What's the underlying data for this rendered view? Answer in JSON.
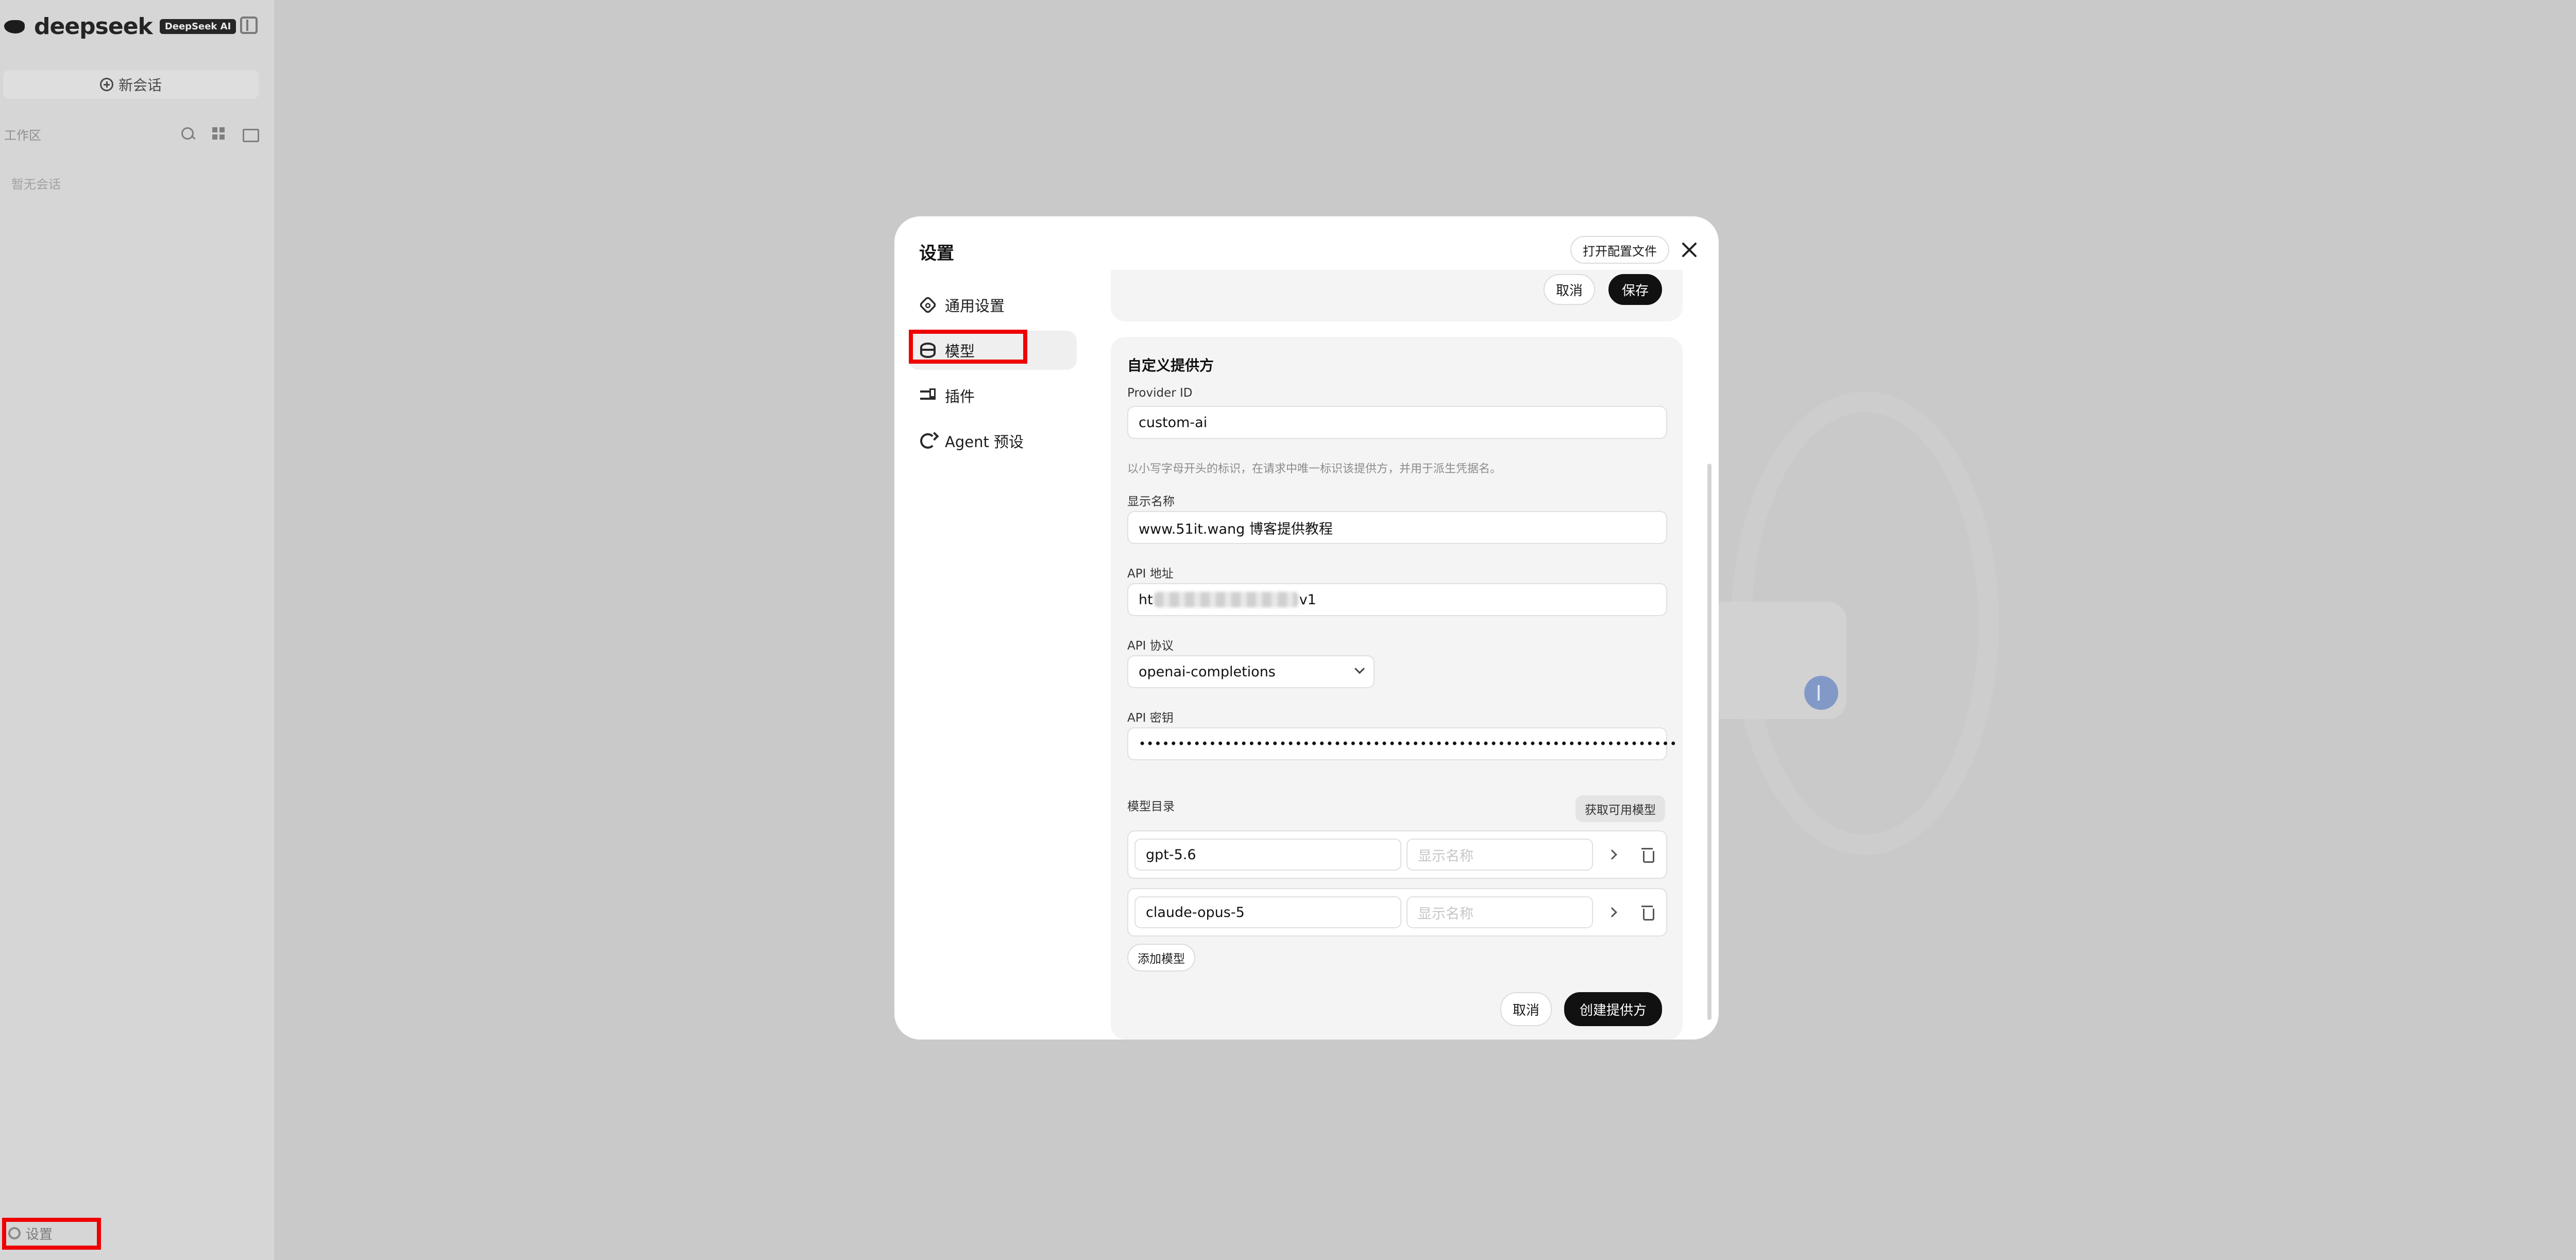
{
  "app": {
    "logo_text": "deepseek",
    "logo_badge": "DeepSeek AI",
    "new_chat_label": "新会话",
    "workspace_label": "工作区",
    "empty_chats": "暂无会话",
    "settings_label": "设置"
  },
  "modal": {
    "title": "设置",
    "open_config_label": "打开配置文件",
    "nav": [
      {
        "label": "通用设置",
        "icon": "gear-icon"
      },
      {
        "label": "模型",
        "icon": "database-icon"
      },
      {
        "label": "插件",
        "icon": "sliders-icon"
      },
      {
        "label": "Agent 预设",
        "icon": "recycle-icon"
      }
    ],
    "active_nav": "模型",
    "top_card": {
      "cancel_label": "取消",
      "save_label": "保存"
    },
    "provider_form": {
      "section_title": "自定义提供方",
      "provider_id_label": "Provider ID",
      "provider_id_value": "custom-ai",
      "provider_id_hint": "以小写字母开头的标识，在请求中唯一标识该提供方，并用于派生凭据名。",
      "display_name_label": "显示名称",
      "display_name_value": "www.51it.wang 博客提供教程",
      "api_url_label": "API 地址",
      "api_url_prefix": "ht",
      "api_url_suffix": "v1",
      "api_protocol_label": "API 协议",
      "api_protocol_value": "openai-completions",
      "api_key_label": "API 密钥",
      "api_key_value": "•••••••••••••••••••••••••••••••••••••••••••••••••••••••••••••••••••••",
      "model_catalog_label": "模型目录",
      "fetch_models_label": "获取可用模型",
      "models": [
        {
          "id": "gpt-5.6",
          "name_placeholder": "显示名称"
        },
        {
          "id": "claude-opus-5",
          "name_placeholder": "显示名称"
        }
      ],
      "add_model_label": "添加模型",
      "cancel_label": "取消",
      "create_label": "创建提供方"
    }
  },
  "colors": {
    "highlight": "#ee0000",
    "primary_button": "#111111",
    "overlay": "#c9c9c9"
  }
}
